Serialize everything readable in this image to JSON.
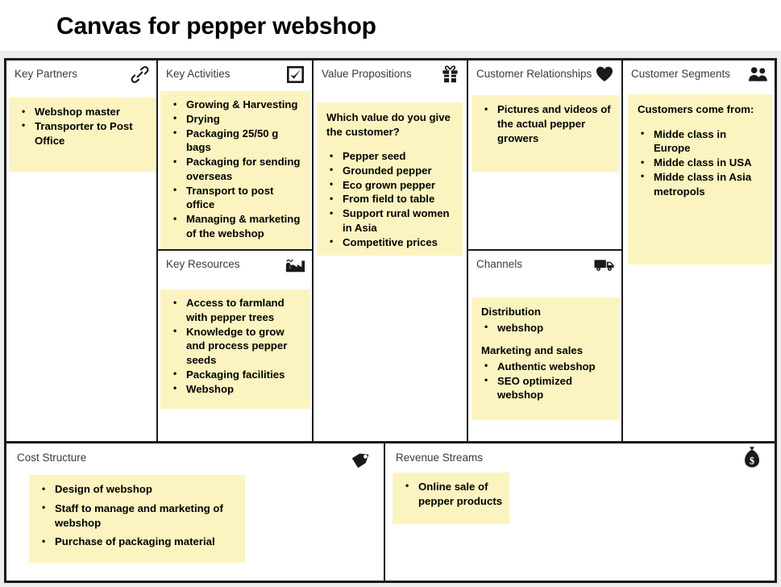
{
  "page_title": "Canvas for pepper webshop",
  "colors": {
    "note_yellow": "#FBF4C0",
    "frame_black": "#1A1A1A",
    "header_gray": "#3B3B3B",
    "backdrop_gray": "#ECEDED"
  },
  "blocks": {
    "key_partners": {
      "title": "Key Partners",
      "icon": "link-icon",
      "items": [
        "Webshop master",
        "Transporter to Post Office"
      ]
    },
    "key_activities": {
      "title": "Key Activities",
      "icon": "checkbox-checked-icon",
      "items": [
        "Growing & Harvesting",
        "Drying",
        "Packaging 25/50 g bags",
        "Packaging for sending overseas",
        "Transport to post office",
        "Managing & marketing of the webshop"
      ]
    },
    "key_resources": {
      "title": "Key Resources",
      "icon": "factory-icon",
      "items": [
        "Access to farmland with pepper trees",
        "Knowledge to grow and process pepper seeds",
        "Packaging facilities",
        "Webshop"
      ]
    },
    "value_propositions": {
      "title": "Value Propositions",
      "icon": "gift-icon",
      "heading": "Which value do you give the customer?",
      "items": [
        "Pepper seed",
        "Grounded pepper",
        "Eco grown pepper",
        "From field to table",
        "Support rural women in Asia",
        "Competitive prices"
      ]
    },
    "customer_relationships": {
      "title": "Customer Relationships",
      "icon": "heart-icon",
      "items": [
        "Pictures and videos of the actual pepper growers"
      ]
    },
    "channels": {
      "title": "Channels",
      "icon": "delivery-truck-icon",
      "group_one_heading": "Distribution",
      "group_one_items": [
        "webshop"
      ],
      "group_two_heading": "Marketing and sales",
      "group_two_items": [
        "Authentic webshop",
        "SEO optimized webshop"
      ]
    },
    "customer_segments": {
      "title": "Customer Segments",
      "icon": "people-icon",
      "heading": "Customers come from:",
      "items": [
        "Midde class in Europe",
        "Midde class in USA",
        "Midde class in Asia metropols"
      ]
    },
    "cost_structure": {
      "title": "Cost Structure",
      "icon": "price-tag-icon",
      "items": [
        "Design of webshop",
        "Staff to manage and marketing of webshop",
        "Purchase of packaging material"
      ]
    },
    "revenue_streams": {
      "title": "Revenue Streams",
      "icon": "money-bag-icon",
      "items": [
        "Online sale of pepper products"
      ]
    }
  }
}
